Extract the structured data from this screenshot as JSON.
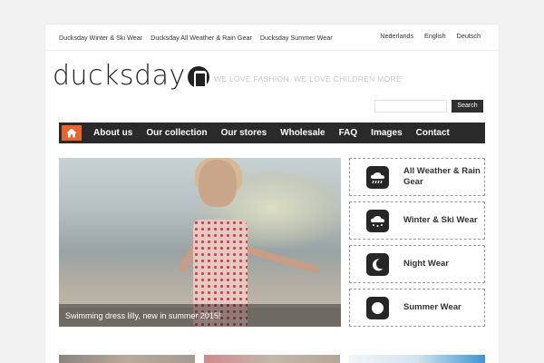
{
  "header": {
    "top_links": [
      "Ducksday Winter & Ski Wear",
      "Ducksday All Weather & Rain Gear",
      "Ducksday Summer Wear"
    ],
    "languages": [
      "Nederlands",
      "English",
      "Deutsch"
    ]
  },
  "logo": {
    "text": "ducksday",
    "tagline": "WE LOVE FASHION, WE LOVE CHILDREN MORE"
  },
  "search": {
    "placeholder": "",
    "button_label": "Search"
  },
  "nav": {
    "home_icon": "home-icon",
    "items": [
      "About us",
      "Our collection",
      "Our stores",
      "Wholesale",
      "FAQ",
      "Images",
      "Contact"
    ]
  },
  "hero": {
    "caption": "Swimming dress lilly, new in summer 2015!"
  },
  "categories": [
    {
      "label": "All Weather & Rain Gear",
      "icon": "rain-cloud-icon"
    },
    {
      "label": "Winter & Ski Wear",
      "icon": "snow-cloud-icon"
    },
    {
      "label": "Night Wear",
      "icon": "moon-icon"
    },
    {
      "label": "Summer Wear",
      "icon": "sun-icon"
    }
  ],
  "colors": {
    "nav_bg": "#2a2a2a",
    "home_accent": "#e8652d",
    "tagline": "#c9c9c9"
  }
}
